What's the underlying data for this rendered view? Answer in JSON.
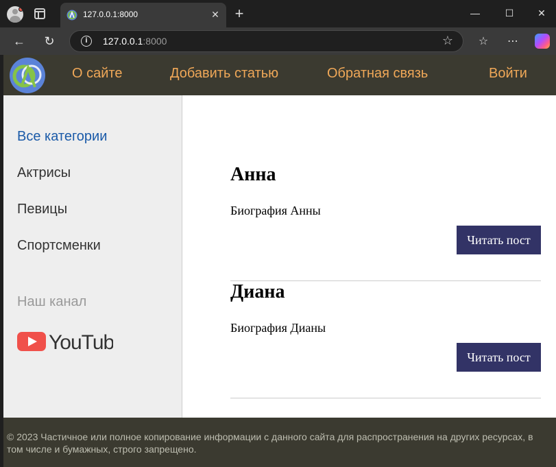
{
  "browser": {
    "tab_title": "127.0.0.1:8000",
    "tab_close": "✕",
    "new_tab": "+",
    "url_host": "127.0.0.1",
    "url_port": ":8000",
    "window_controls": {
      "minimize": "—",
      "maximize": "☐",
      "close": "✕"
    },
    "nav": {
      "back": "←",
      "reload": "↻"
    },
    "tools": {
      "favorites": "☆",
      "more": "⋯"
    }
  },
  "site": {
    "menu": [
      {
        "label": "О сайте"
      },
      {
        "label": "Добавить статью"
      },
      {
        "label": "Обратная связь"
      },
      {
        "label": "Войти"
      }
    ],
    "categories": [
      {
        "label": "Все категории",
        "active": true
      },
      {
        "label": "Актрисы",
        "active": false
      },
      {
        "label": "Певицы",
        "active": false
      },
      {
        "label": "Спортсменки",
        "active": false
      }
    ],
    "channel_label": "Наш канал",
    "youtube_wordmark": "YouTube",
    "posts": [
      {
        "title": "Анна",
        "excerpt": "Биография Анны",
        "button": "Читать пост"
      },
      {
        "title": "Диана",
        "excerpt": "Биография Дианы",
        "button": "Читать пост"
      }
    ],
    "footer": "© 2023 Частичное или полное копирование информации с данного сайта для распространения на других ресурсах, в том числе и бумажных, строго запрещено."
  },
  "colors": {
    "header_bg": "#3b3a30",
    "menu_link": "#f0a858",
    "active_category": "#1a5aa8",
    "button_bg": "#323366",
    "sidebar_bg": "#eeeeee"
  },
  "icons": {
    "logo": "site-logo-icon",
    "youtube": "youtube-logo-icon"
  }
}
